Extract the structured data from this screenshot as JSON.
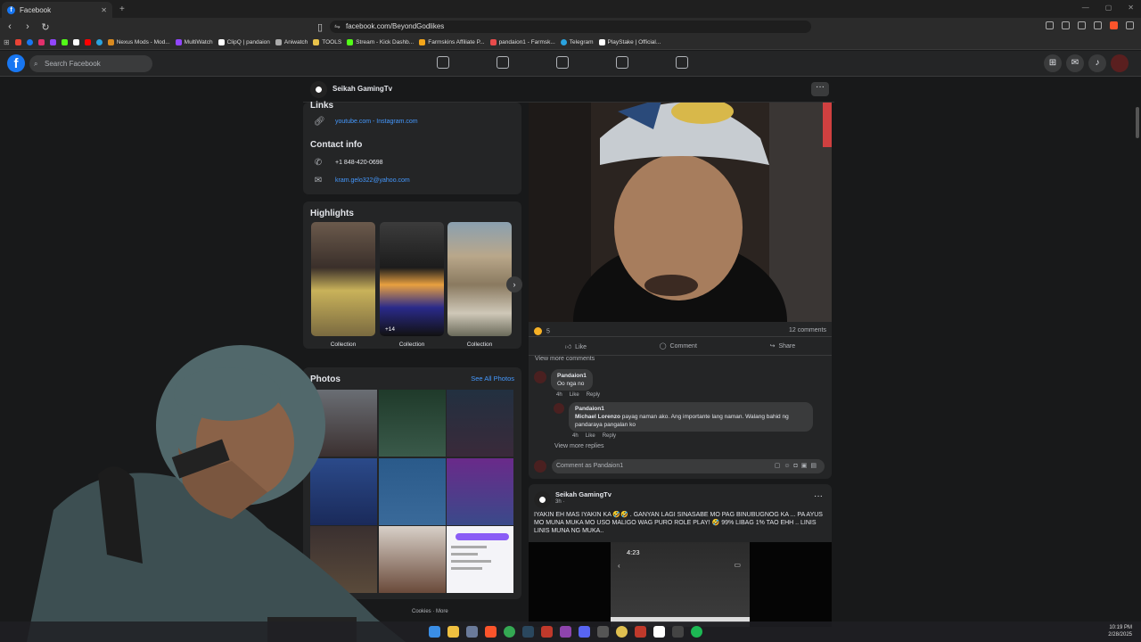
{
  "browser": {
    "tab_title": "Facebook",
    "url": "facebook.com/BeyondGodlikes",
    "bookmarks": [
      {
        "label": "Nexus Mods - Mod...",
        "color": "#d98a20"
      },
      {
        "label": "MultiWatch",
        "color": "#9146ff"
      },
      {
        "label": "ClipQ | pandaion",
        "color": "#ffffff"
      },
      {
        "label": "Aniwatch",
        "color": "#aaaaaa"
      },
      {
        "label": "TOOLS",
        "color": "#e8c24a"
      },
      {
        "label": "Stream - Kick Dashb...",
        "color": "#53fc18"
      },
      {
        "label": "Farmskins Affiliate P...",
        "color": "#f2a51a"
      },
      {
        "label": "pandaion1 - Farmsk...",
        "color": "#e84b4b"
      },
      {
        "label": "Telegram",
        "color": "#2aa3df"
      },
      {
        "label": "PlayStake | Official...",
        "color": "#ffffff"
      }
    ]
  },
  "facebook": {
    "search_placeholder": "Search Facebook",
    "page_name": "Seikah GamingTv",
    "more_label": "···"
  },
  "intro": {
    "links_title": "Links",
    "links_text": "youtube.com - Instagram.com",
    "contact_title": "Contact info",
    "phone": "+1 848-420-0698",
    "email": "kram.gelo322@yahoo.com"
  },
  "highlights": {
    "title": "Highlights",
    "items": [
      {
        "caption": "Collection"
      },
      {
        "caption": "Collection",
        "count": "+14"
      },
      {
        "caption": "Collection"
      }
    ]
  },
  "photos": {
    "title": "Photos",
    "see_all": "See All Photos",
    "footer": "Cookies · More"
  },
  "post1": {
    "reaction_count": "5",
    "comment_count": "12 comments",
    "like": "Like",
    "comment": "Comment",
    "share": "Share",
    "view_more_comments": "View more comments",
    "comment1": {
      "author": "Pandaion1",
      "text": "Oo nga no",
      "time": "4h",
      "like": "Like",
      "reply": "Reply"
    },
    "comment2": {
      "author": "Pandaion1",
      "mention": "Michael Lorenzo",
      "text": "payag naman ako. Ang importante lang naman. Walang bahid ng pandaraya pangalan ko",
      "time": "4h",
      "like": "Like",
      "reply": "Reply"
    },
    "view_more_replies": "View more replies",
    "comment_placeholder": "Comment as Pandaion1"
  },
  "post2": {
    "author": "Seikah GamingTv",
    "time": "3h ·",
    "text": "IYAKIN EH MAS IYAKIN KA 🤣🤣 . GANYAN LAGI SINASABE MO PAG BINUBUGNOG KA ... PA AYUS MO MUNA MUKA MO USO MALIGO WAG PURO ROLE PLAY! 🤣 99% LIBAG 1% TAO EHH .. LINIS LINIS MUNA NG MUKA..",
    "phone_time": "4:23"
  },
  "taskbar": {
    "time": "10:19 PM",
    "date": "2/28/2025"
  }
}
